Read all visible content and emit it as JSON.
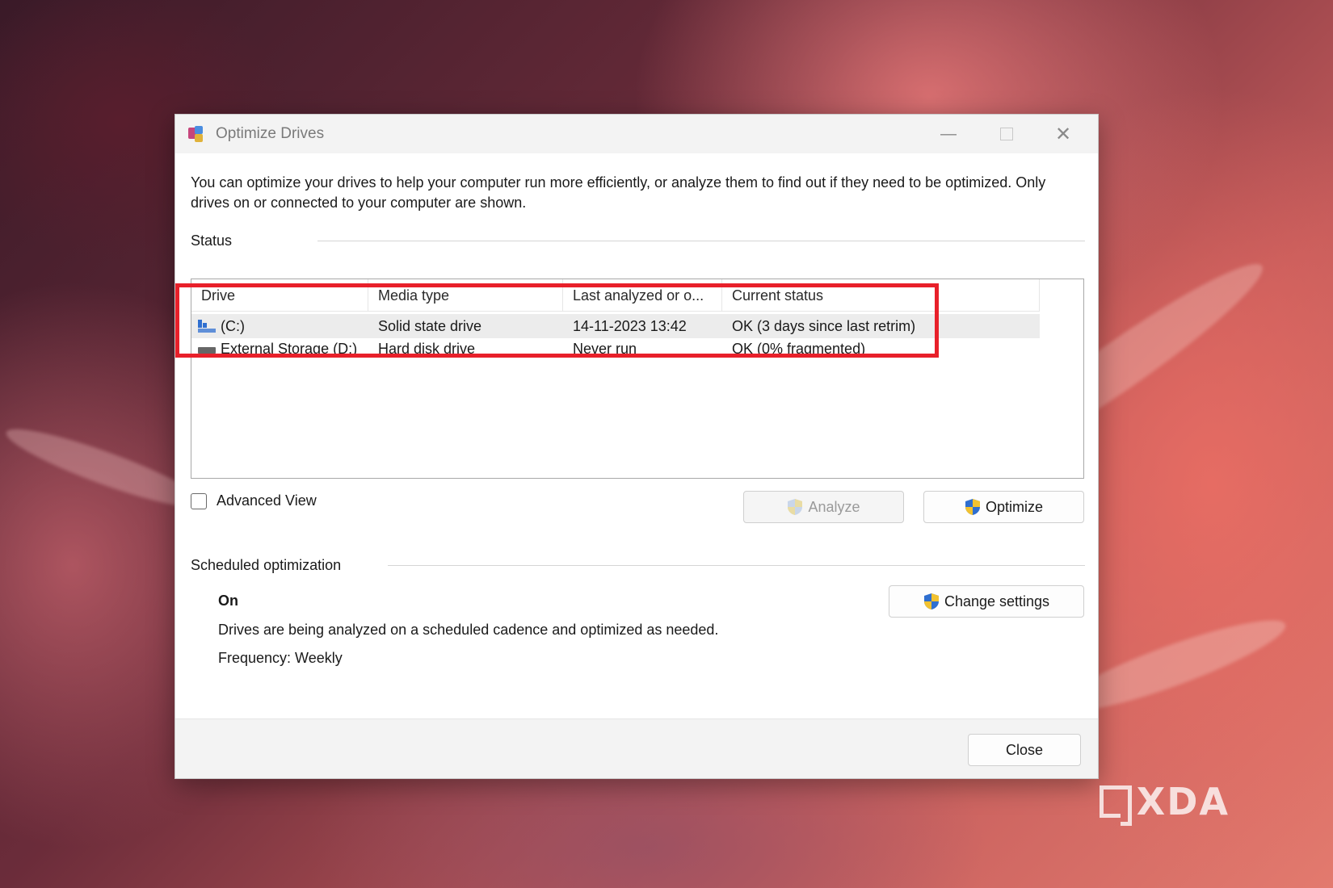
{
  "window": {
    "title": "Optimize Drives",
    "minimize_glyph": "—",
    "close_glyph": "✕"
  },
  "intro_text": "You can optimize your drives to help your computer run more efficiently, or analyze them to find out if they need to be optimized. Only drives on or connected to your computer are shown.",
  "status": {
    "label": "Status",
    "columns": [
      "Drive",
      "Media type",
      "Last analyzed or o...",
      "Current status"
    ],
    "drives": [
      {
        "drive": "(C:)",
        "media_type": "Solid state drive",
        "last_analyzed": "14-11-2023 13:42",
        "status": "OK (3 days since last retrim)",
        "icon": "ssd-drive-icon"
      },
      {
        "drive": "External Storage (D:)",
        "media_type": "Hard disk drive",
        "last_analyzed": "Never run",
        "status": "OK (0% fragmented)",
        "icon": "hdd-drive-icon"
      }
    ]
  },
  "advanced_view_label": "Advanced View",
  "buttons": {
    "analyze": "Analyze",
    "optimize": "Optimize",
    "change_settings": "Change settings",
    "close": "Close"
  },
  "scheduled": {
    "label": "Scheduled optimization",
    "state": "On",
    "description": "Drives are being analyzed on a scheduled cadence and optimized as needed.",
    "frequency": "Frequency: Weekly"
  },
  "watermark": "XDA",
  "colors": {
    "highlight": "#e8202a",
    "shield_blue": "#2f6fd0",
    "shield_yellow": "#f2c230"
  }
}
